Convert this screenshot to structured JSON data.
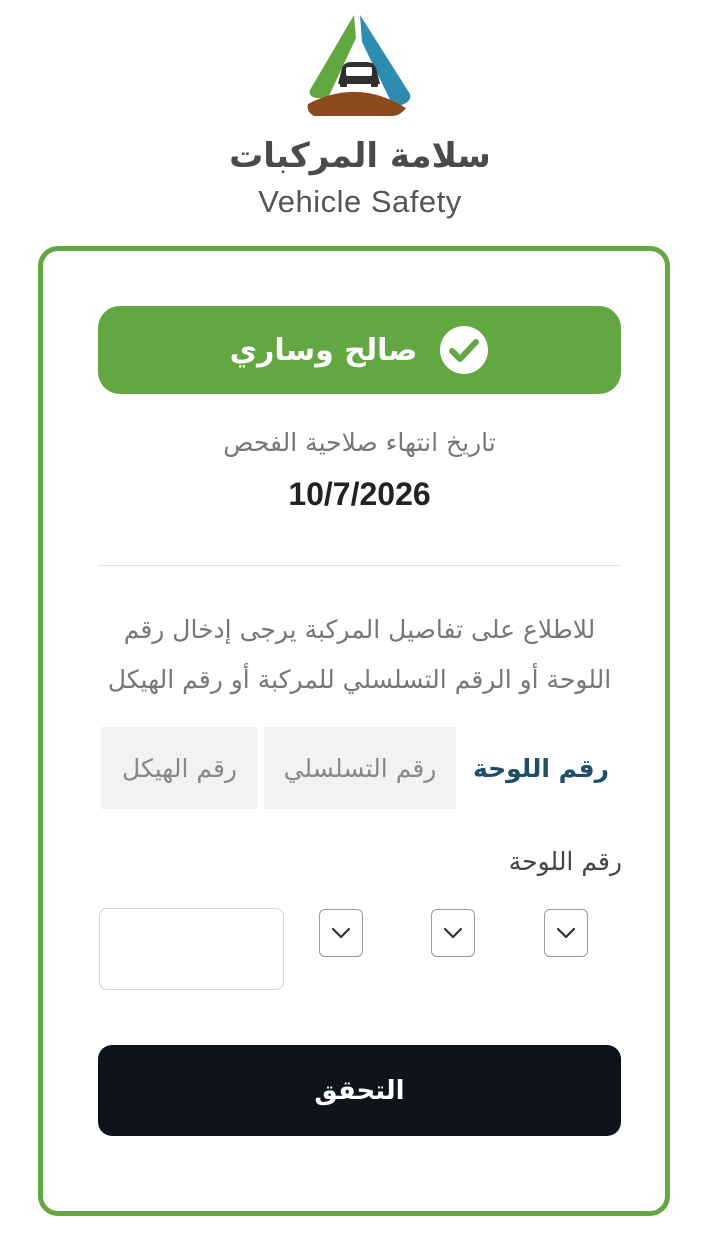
{
  "brand": {
    "name_ar": "سلامة المركبات",
    "name_en": "Vehicle Safety",
    "logo_icon": "vehicle-safety-logo",
    "colors": {
      "green": "#63a743",
      "blue": "#2e8cb0",
      "brown": "#8b4a1c",
      "dark": "#0f131c"
    }
  },
  "status": {
    "label": "صالح وساري",
    "icon": "check-circle-icon"
  },
  "inspection": {
    "expiry_label": "تاريخ انتهاء صلاحية الفحص",
    "expiry_date": "10/7/2026"
  },
  "form": {
    "instruction_line1": "للاطلاع على تفاصيل المركبة يرجى إدخال رقم",
    "instruction_line2": "اللوحة أو الرقم التسلسلي للمركبة أو رقم الهيكل",
    "tabs": [
      {
        "label": "رقم اللوحة",
        "active": true
      },
      {
        "label": "رقم التسلسلي",
        "active": false
      },
      {
        "label": "رقم الهيكل",
        "active": false
      }
    ],
    "plate_label": "رقم اللوحة",
    "letter_selects": [
      "",
      "",
      ""
    ],
    "number_value": "",
    "submit_label": "التحقق"
  }
}
